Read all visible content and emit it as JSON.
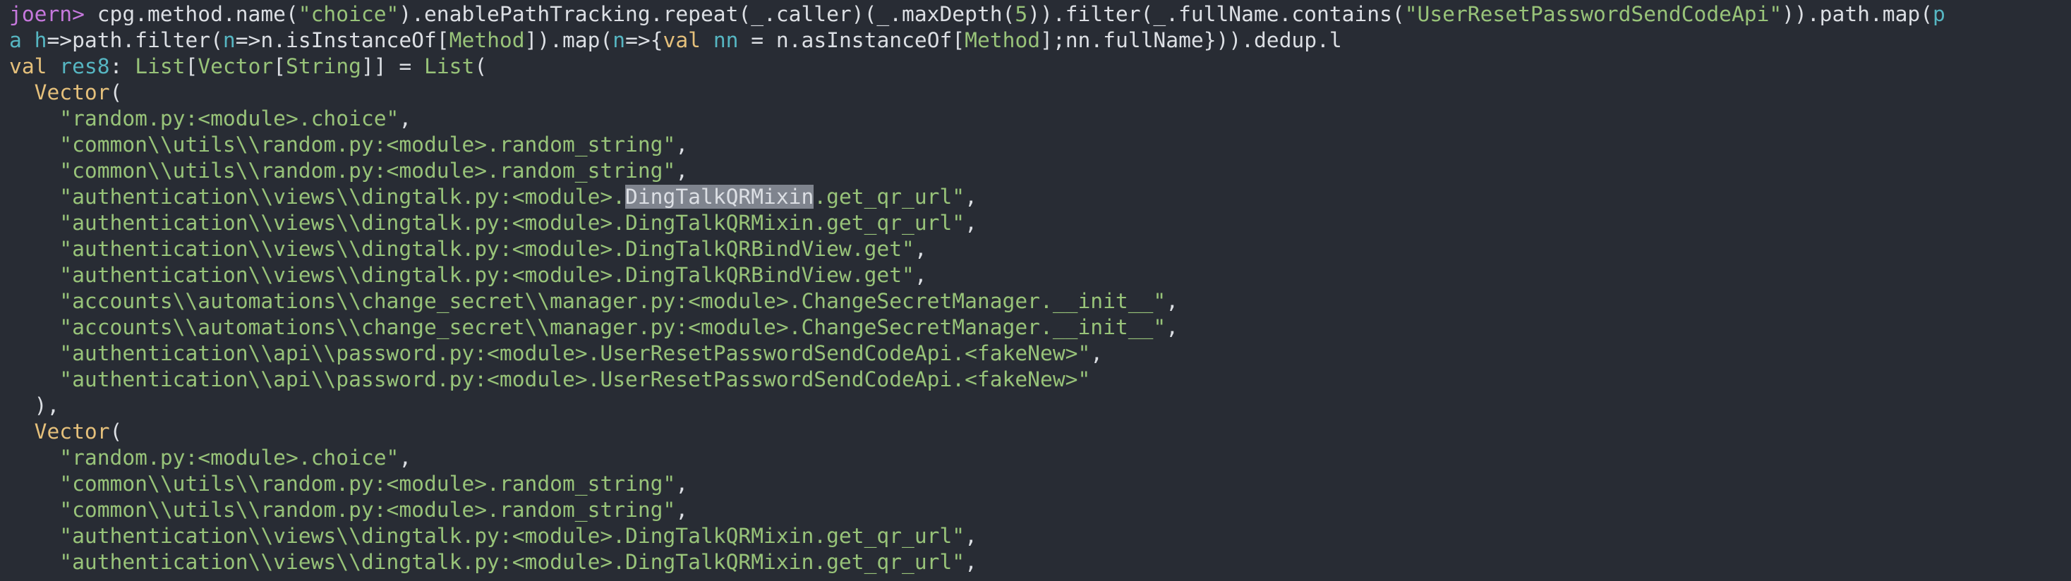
{
  "terminal": {
    "lines": [
      [
        {
          "t": "joern> ",
          "c": "prompt"
        },
        {
          "t": "cpg.method.name(",
          "c": "plain"
        },
        {
          "t": "\"choice\"",
          "c": "str"
        },
        {
          "t": ").enablePathTracking.repeat(_.caller)(_.maxDepth(",
          "c": "plain"
        },
        {
          "t": "5",
          "c": "num"
        },
        {
          "t": ")).filter(_.fullName.contains(",
          "c": "plain"
        },
        {
          "t": "\"UserResetPasswordSendCodeApi\"",
          "c": "str"
        },
        {
          "t": ")).path.map(",
          "c": "plain"
        },
        {
          "t": "p",
          "c": "var"
        }
      ],
      [
        {
          "t": "a ",
          "c": "var"
        },
        {
          "t": "h",
          "c": "var"
        },
        {
          "t": "=>path.filter(",
          "c": "plain"
        },
        {
          "t": "n",
          "c": "var"
        },
        {
          "t": "=>n.isInstanceOf[",
          "c": "plain"
        },
        {
          "t": "Method",
          "c": "str"
        },
        {
          "t": "]).map(",
          "c": "plain"
        },
        {
          "t": "n",
          "c": "var"
        },
        {
          "t": "=>{",
          "c": "plain"
        },
        {
          "t": "val",
          "c": "kw"
        },
        {
          "t": " ",
          "c": "plain"
        },
        {
          "t": "nn",
          "c": "var"
        },
        {
          "t": " = n.asInstanceOf[",
          "c": "plain"
        },
        {
          "t": "Method",
          "c": "str"
        },
        {
          "t": "];nn.fullName})).dedup.l",
          "c": "plain"
        }
      ],
      [
        {
          "t": "val",
          "c": "kw"
        },
        {
          "t": " ",
          "c": "plain"
        },
        {
          "t": "res8",
          "c": "var"
        },
        {
          "t": ": ",
          "c": "plain"
        },
        {
          "t": "List",
          "c": "str"
        },
        {
          "t": "[",
          "c": "plain"
        },
        {
          "t": "Vector",
          "c": "str"
        },
        {
          "t": "[",
          "c": "plain"
        },
        {
          "t": "String",
          "c": "str"
        },
        {
          "t": "]] = ",
          "c": "plain"
        },
        {
          "t": "List",
          "c": "str"
        },
        {
          "t": "(",
          "c": "plain"
        }
      ],
      [
        {
          "t": "  ",
          "c": "plain"
        },
        {
          "t": "Vector",
          "c": "type"
        },
        {
          "t": "(",
          "c": "plain"
        }
      ],
      [
        {
          "t": "    ",
          "c": "plain"
        },
        {
          "t": "\"random.py:<module>.choice\"",
          "c": "str"
        },
        {
          "t": ",",
          "c": "plain"
        }
      ],
      [
        {
          "t": "    ",
          "c": "plain"
        },
        {
          "t": "\"common\\\\utils\\\\random.py:<module>.random_string\"",
          "c": "str"
        },
        {
          "t": ",",
          "c": "plain"
        }
      ],
      [
        {
          "t": "    ",
          "c": "plain"
        },
        {
          "t": "\"common\\\\utils\\\\random.py:<module>.random_string\"",
          "c": "str"
        },
        {
          "t": ",",
          "c": "plain"
        }
      ],
      [
        {
          "t": "    ",
          "c": "plain"
        },
        {
          "t": "\"authentication\\\\views\\\\dingtalk.py:<module>.",
          "c": "str"
        },
        {
          "t": "DingTalkQRMixin",
          "c": "hl"
        },
        {
          "t": ".get_qr_url\"",
          "c": "str"
        },
        {
          "t": ",",
          "c": "plain"
        }
      ],
      [
        {
          "t": "    ",
          "c": "plain"
        },
        {
          "t": "\"authentication\\\\views\\\\dingtalk.py:<module>.DingTalkQRMixin.get_qr_url\"",
          "c": "str"
        },
        {
          "t": ",",
          "c": "plain"
        }
      ],
      [
        {
          "t": "    ",
          "c": "plain"
        },
        {
          "t": "\"authentication\\\\views\\\\dingtalk.py:<module>.DingTalkQRBindView.get\"",
          "c": "str"
        },
        {
          "t": ",",
          "c": "plain"
        }
      ],
      [
        {
          "t": "    ",
          "c": "plain"
        },
        {
          "t": "\"authentication\\\\views\\\\dingtalk.py:<module>.DingTalkQRBindView.get\"",
          "c": "str"
        },
        {
          "t": ",",
          "c": "plain"
        }
      ],
      [
        {
          "t": "    ",
          "c": "plain"
        },
        {
          "t": "\"accounts\\\\automations\\\\change_secret\\\\manager.py:<module>.ChangeSecretManager.__init__\"",
          "c": "str"
        },
        {
          "t": ",",
          "c": "plain"
        }
      ],
      [
        {
          "t": "    ",
          "c": "plain"
        },
        {
          "t": "\"accounts\\\\automations\\\\change_secret\\\\manager.py:<module>.ChangeSecretManager.__init__\"",
          "c": "str"
        },
        {
          "t": ",",
          "c": "plain"
        }
      ],
      [
        {
          "t": "    ",
          "c": "plain"
        },
        {
          "t": "\"authentication\\\\api\\\\password.py:<module>.UserResetPasswordSendCodeApi.<fakeNew>\"",
          "c": "str"
        },
        {
          "t": ",",
          "c": "plain"
        }
      ],
      [
        {
          "t": "    ",
          "c": "plain"
        },
        {
          "t": "\"authentication\\\\api\\\\password.py:<module>.UserResetPasswordSendCodeApi.<fakeNew>\"",
          "c": "str"
        }
      ],
      [
        {
          "t": "  ),",
          "c": "plain"
        }
      ],
      [
        {
          "t": "  ",
          "c": "plain"
        },
        {
          "t": "Vector",
          "c": "type"
        },
        {
          "t": "(",
          "c": "plain"
        }
      ],
      [
        {
          "t": "    ",
          "c": "plain"
        },
        {
          "t": "\"random.py:<module>.choice\"",
          "c": "str"
        },
        {
          "t": ",",
          "c": "plain"
        }
      ],
      [
        {
          "t": "    ",
          "c": "plain"
        },
        {
          "t": "\"common\\\\utils\\\\random.py:<module>.random_string\"",
          "c": "str"
        },
        {
          "t": ",",
          "c": "plain"
        }
      ],
      [
        {
          "t": "    ",
          "c": "plain"
        },
        {
          "t": "\"common\\\\utils\\\\random.py:<module>.random_string\"",
          "c": "str"
        },
        {
          "t": ",",
          "c": "plain"
        }
      ],
      [
        {
          "t": "    ",
          "c": "plain"
        },
        {
          "t": "\"authentication\\\\views\\\\dingtalk.py:<module>.DingTalkQRMixin.get_qr_url\"",
          "c": "str"
        },
        {
          "t": ",",
          "c": "plain"
        }
      ],
      [
        {
          "t": "    ",
          "c": "plain"
        },
        {
          "t": "\"authentication\\\\views\\\\dingtalk.py:<module>.DingTalkQRMixin.get_qr_url\"",
          "c": "str"
        },
        {
          "t": ",",
          "c": "plain"
        }
      ]
    ]
  },
  "colors": {
    "background": "#282c34",
    "plain": "#dcdfe4",
    "string": "#98c379",
    "prompt": "#c678dd",
    "type": "#e5c07b",
    "variable": "#56b6c2",
    "selection": "#7f848e"
  }
}
